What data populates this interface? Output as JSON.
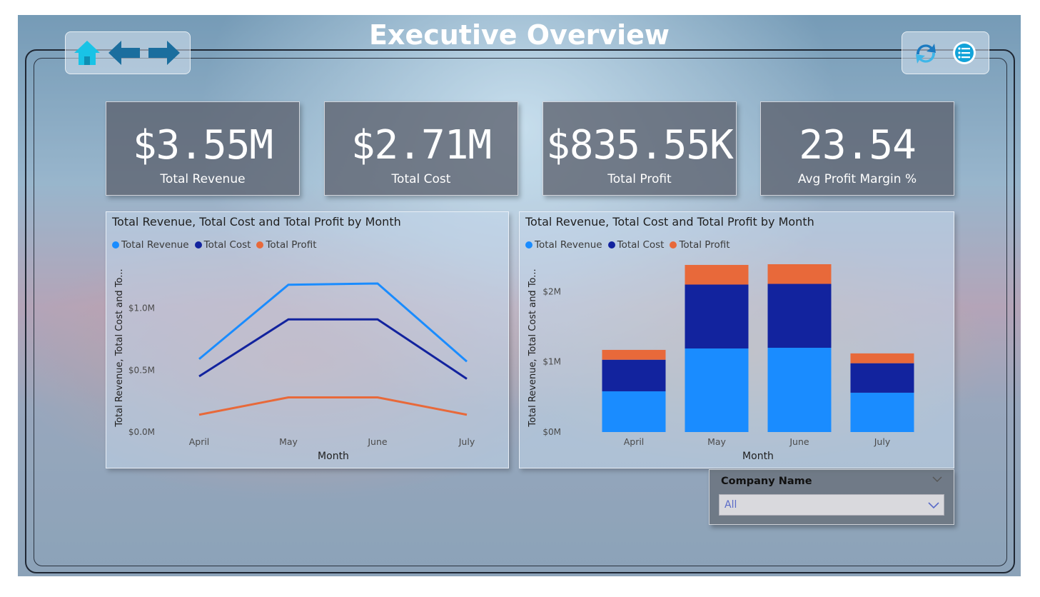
{
  "page": {
    "title": "Executive Overview"
  },
  "nav": {
    "home_icon": "home-icon",
    "back_icon": "arrow-left-icon",
    "forward_icon": "arrow-right-icon",
    "refresh_icon": "refresh-icon",
    "menu_icon": "list-menu-icon"
  },
  "kpis": [
    {
      "value": "$3.55M",
      "label": "Total Revenue"
    },
    {
      "value": "$2.71M",
      "label": "Total Cost"
    },
    {
      "value": "$835.55K",
      "label": "Total Profit"
    },
    {
      "value": "23.54",
      "label": "Avg Profit Margin %"
    }
  ],
  "colors": {
    "revenue": "#1a8cff",
    "cost": "#12239e",
    "profit": "#e8693a"
  },
  "chart_data": [
    {
      "type": "line",
      "title": "Total Revenue, Total Cost and Total Profit by Month",
      "xlabel": "Month",
      "ylabel": "Total Revenue, Total Cost and To...",
      "categories": [
        "April",
        "May",
        "June",
        "July"
      ],
      "yticks": [
        "$0.0M",
        "$0.5M",
        "$1.0M"
      ],
      "ylim": [
        0,
        1.2
      ],
      "legend_position": "top-left",
      "series": [
        {
          "name": "Total Revenue",
          "values": [
            0.59,
            1.19,
            1.2,
            0.57
          ]
        },
        {
          "name": "Total Cost",
          "values": [
            0.45,
            0.91,
            0.91,
            0.43
          ]
        },
        {
          "name": "Total Profit",
          "values": [
            0.14,
            0.28,
            0.28,
            0.14
          ]
        }
      ]
    },
    {
      "type": "bar",
      "stacked": true,
      "title": "Total Revenue, Total Cost and Total Profit by Month",
      "xlabel": "Month",
      "ylabel": "Total Revenue, Total Cost and To...",
      "categories": [
        "April",
        "May",
        "June",
        "July"
      ],
      "yticks": [
        "$0M",
        "$1M",
        "$2M"
      ],
      "ylim": [
        0,
        2.4
      ],
      "legend_position": "top-left",
      "series": [
        {
          "name": "Total Revenue",
          "values": [
            0.58,
            1.19,
            1.2,
            0.56
          ]
        },
        {
          "name": "Total Cost",
          "values": [
            0.45,
            0.91,
            0.91,
            0.42
          ]
        },
        {
          "name": "Total Profit",
          "values": [
            0.14,
            0.28,
            0.28,
            0.14
          ]
        }
      ]
    }
  ],
  "slicer": {
    "title": "Company Name",
    "value": "All"
  }
}
